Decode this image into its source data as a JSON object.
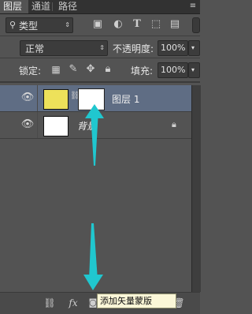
{
  "tabs": [
    {
      "label": "图层"
    },
    {
      "label": "通道"
    },
    {
      "label": "路径"
    }
  ],
  "filter": {
    "selected": "类型"
  },
  "blend": {
    "mode": "正常",
    "opacity_label": "不透明度:",
    "opacity_value": "100%"
  },
  "lock": {
    "label": "锁定:",
    "fill_label": "填充:",
    "fill_value": "100%"
  },
  "layers": [
    {
      "name": "图层 1",
      "color_thumb": "#ede15a",
      "selected": true
    },
    {
      "name": "背景",
      "color_thumb": "#ffffff",
      "selected": false
    }
  ],
  "tooltip": {
    "text": "添加矢量蒙版"
  },
  "colors": {
    "panel": "#535353",
    "selected_row": "#5f6d84",
    "annotation_arrow": "#20c7cf"
  }
}
